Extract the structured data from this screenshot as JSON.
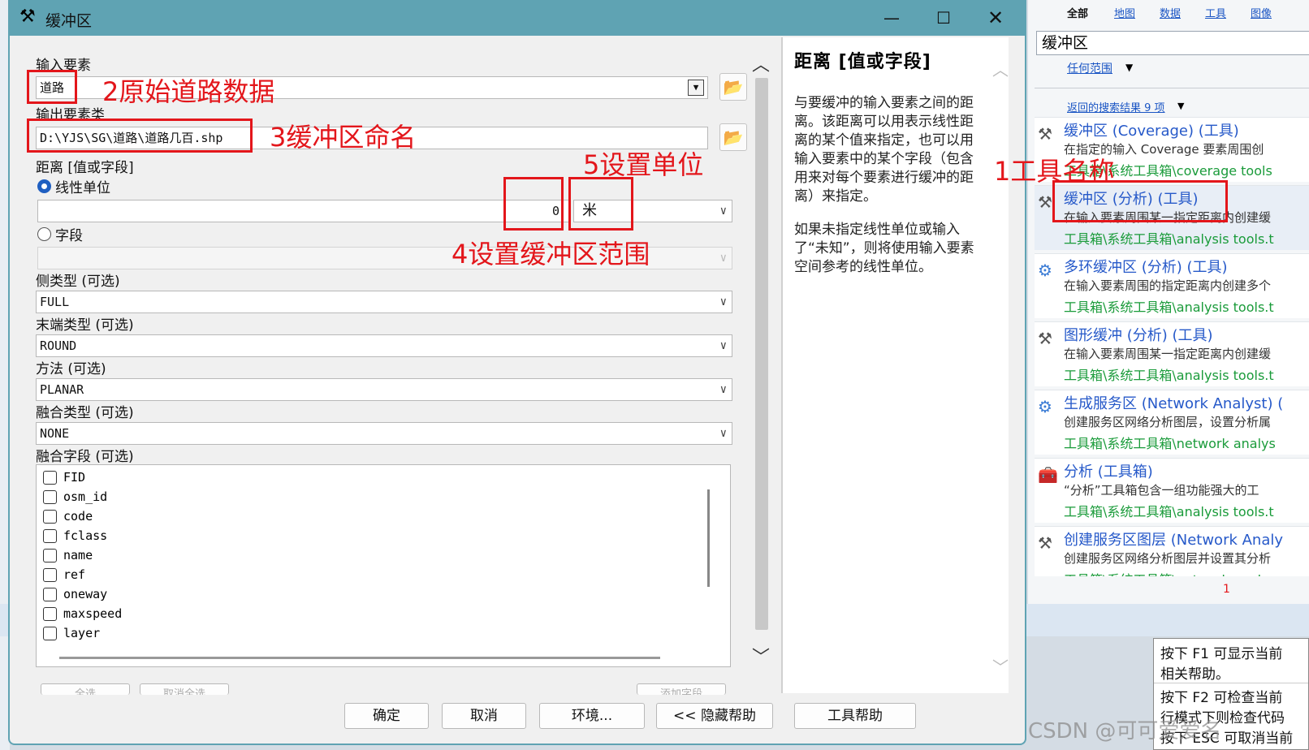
{
  "dialog": {
    "title": "缓冲区",
    "input_label": "输入要素",
    "input_value": "道路",
    "output_label": "输出要素类",
    "output_value": "D:\\YJS\\SG\\道路\\道路几百.shp",
    "distance_label": "距离 [值或字段]",
    "linear_unit_label": "线性单位",
    "distance_value": "0",
    "unit_value": "米",
    "field_label": "字段",
    "side_type_label": "侧类型 (可选)",
    "side_type_value": "FULL",
    "end_type_label": "末端类型 (可选)",
    "end_type_value": "ROUND",
    "method_label": "方法 (可选)",
    "method_value": "PLANAR",
    "dissolve_type_label": "融合类型 (可选)",
    "dissolve_type_value": "NONE",
    "dissolve_field_label": "融合字段 (可选)",
    "dissolve_fields": [
      "FID",
      "osm_id",
      "code",
      "fclass",
      "name",
      "ref",
      "oneway",
      "maxspeed",
      "layer"
    ],
    "select_all": "全选",
    "unselect_all": "取消全选",
    "add_field": "添加字段",
    "buttons": {
      "ok": "确定",
      "cancel": "取消",
      "env": "环境...",
      "hide_help": "<< 隐藏帮助",
      "tool_help": "工具帮助"
    }
  },
  "help": {
    "title": "距离 [值或字段]",
    "para1": "与要缓冲的输入要素之间的距离。该距离可以用表示线性距离的某个值来指定，也可以用输入要素中的某个字段（包含用来对每个要素进行缓冲的距离）来指定。",
    "para2": "如果未指定线性单位或输入了“未知”，则将使用输入要素空间参考的线性单位。"
  },
  "annotations": {
    "a1": "1工具名称",
    "a2": "2原始道路数据",
    "a3": "3缓冲区命名",
    "a4": "4设置缓冲区范围",
    "a5": "5设置单位"
  },
  "search": {
    "tabs": [
      "全部",
      "地图",
      "数据",
      "工具",
      "图像"
    ],
    "query": "缓冲区",
    "scope": "任何范围",
    "results_link": "返回的搜索结果 9 项",
    "results": [
      {
        "title": "缓冲区 (Coverage) (工具)",
        "desc": "在指定的输入 Coverage 要素周围创",
        "path": "工具箱\\系统工具箱\\coverage tools"
      },
      {
        "title": "缓冲区 (分析) (工具)",
        "desc": "在输入要素周围某一指定距离内创建缓",
        "path": "工具箱\\系统工具箱\\analysis tools.t"
      },
      {
        "title": "多环缓冲区 (分析) (工具)",
        "desc": "在输入要素周围的指定距离内创建多个",
        "path": "工具箱\\系统工具箱\\analysis tools.t"
      },
      {
        "title": "图形缓冲 (分析) (工具)",
        "desc": "在输入要素周围某一指定距离内创建缓",
        "path": "工具箱\\系统工具箱\\analysis tools.t"
      },
      {
        "title": "生成服务区 (Network Analyst) (",
        "desc": "创建服务区网络分析图层，设置分析属",
        "path": "工具箱\\系统工具箱\\network analys"
      },
      {
        "title": "分析 (工具箱)",
        "desc": "“分析”工具箱包含一组功能强大的工",
        "path": "工具箱\\系统工具箱\\analysis tools.t"
      },
      {
        "title": "创建服务区图层 (Network Analy",
        "desc": "创建服务区网络分析图层并设置其分析",
        "path": "工具箱\\系统工具箱\\network analys"
      }
    ],
    "page": "1"
  },
  "f1": {
    "lines": [
      "按下 F1 可显示当前",
      "相关帮助。",
      "按下 F2 可检查当前",
      "行模式下则检查代码",
      "按下 ESC 可取消当前"
    ]
  },
  "watermark": "CSDN @可可爱爱名"
}
